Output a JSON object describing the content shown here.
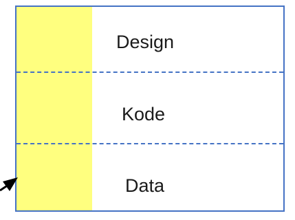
{
  "diagram": {
    "sections": [
      {
        "label": "Design"
      },
      {
        "label": "Kode"
      },
      {
        "label": "Data"
      }
    ],
    "colors": {
      "border": "#4472c4",
      "strip": "#ffff7f",
      "text": "#1a1a1a"
    }
  }
}
